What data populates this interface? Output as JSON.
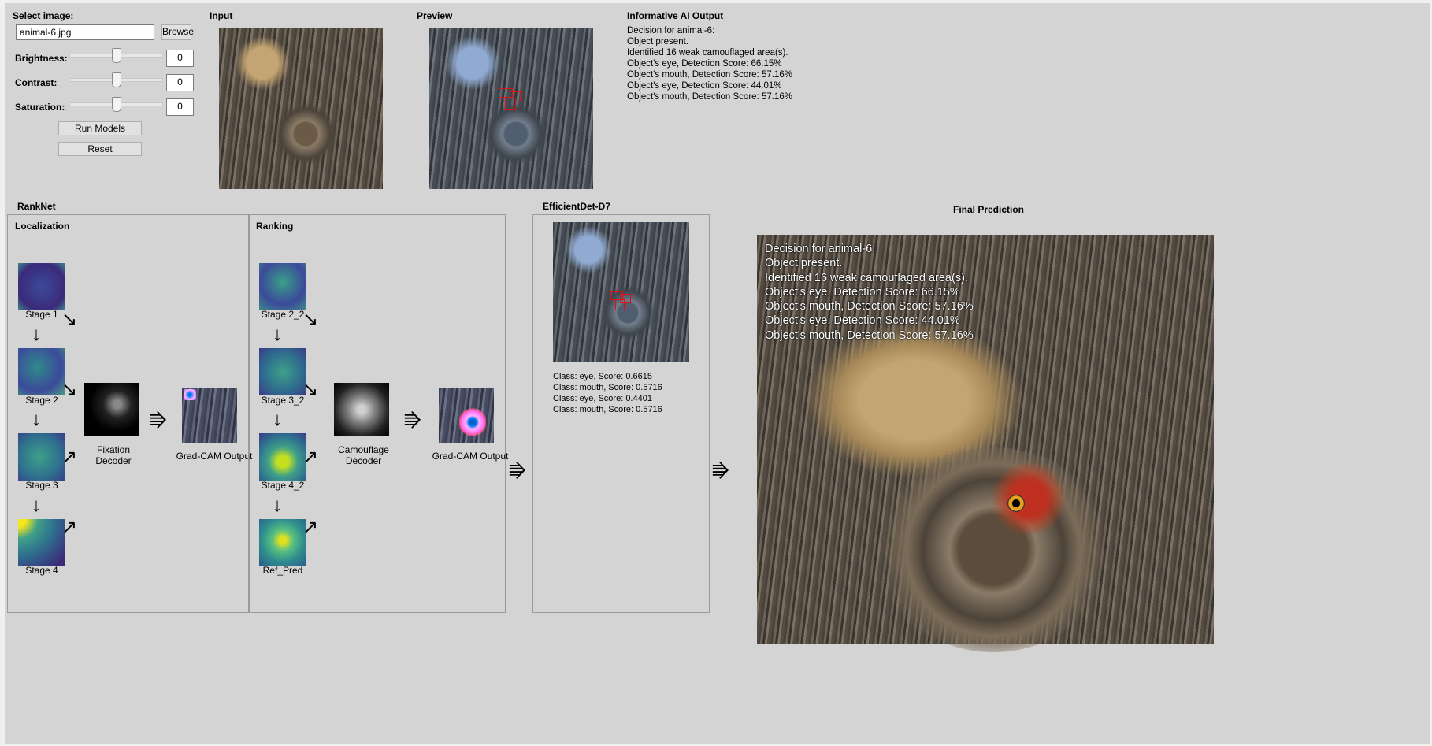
{
  "controls": {
    "select_label": "Select image:",
    "file_value": "animal-6.jpg",
    "browse_label": "Browse",
    "sliders": [
      {
        "label": "Brightness:",
        "value": "0"
      },
      {
        "label": "Contrast:",
        "value": "0"
      },
      {
        "label": "Saturation:",
        "value": "0"
      }
    ],
    "run_label": "Run Models",
    "reset_label": "Reset"
  },
  "panels": {
    "input_title": "Input",
    "preview_title": "Preview",
    "output_title": "Informative AI Output"
  },
  "ai_output": [
    "Decision for animal-6:",
    "Object present.",
    "Identified 16 weak camouflaged area(s).",
    "Object's eye, Detection Score: 66.15%",
    "Object's mouth, Detection Score: 57.16%",
    "Object's eye, Detection Score: 44.01%",
    "Object's mouth, Detection Score: 57.16%"
  ],
  "ranknet": {
    "title": "RankNet",
    "localization": {
      "title": "Localization",
      "stages": [
        "Stage 1",
        "Stage 2",
        "Stage 3",
        "Stage 4"
      ],
      "decoder": "Fixation Decoder",
      "gradcam": "Grad-CAM Output"
    },
    "ranking": {
      "title": "Ranking",
      "stages": [
        "Stage 2_2",
        "Stage 3_2",
        "Stage 4_2",
        "Ref_Pred"
      ],
      "decoder": "Camouflage Decoder",
      "gradcam": "Grad-CAM Output"
    }
  },
  "efficientdet": {
    "title": "EfficientDet-D7",
    "results": [
      "Class: eye, Score: 0.6615",
      "Class: mouth, Score: 0.5716",
      "Class: eye, Score: 0.4401",
      "Class: mouth, Score: 0.5716"
    ]
  },
  "final": {
    "title": "Final Prediction",
    "overlay": [
      "Decision for animal-6:",
      "Object present.",
      "Identified 16 weak camouflaged area(s).",
      "Object's eye, Detection Score: 66.15%",
      "Object's mouth, Detection Score: 57.16%",
      "Object's eye, Detection Score: 44.01%",
      "Object's mouth, Detection Score: 57.16%"
    ]
  },
  "glyphs": {
    "arrow_down": "↓",
    "arrow_diag_down": "↘",
    "arrow_diag_up": "↗",
    "arrow_flow": "⭆"
  },
  "colors": {
    "window_bg": "#d4d4d4",
    "detection_box": "#e01010",
    "viridis_low": "#3b2a7a",
    "viridis_high": "#f5e51e"
  }
}
